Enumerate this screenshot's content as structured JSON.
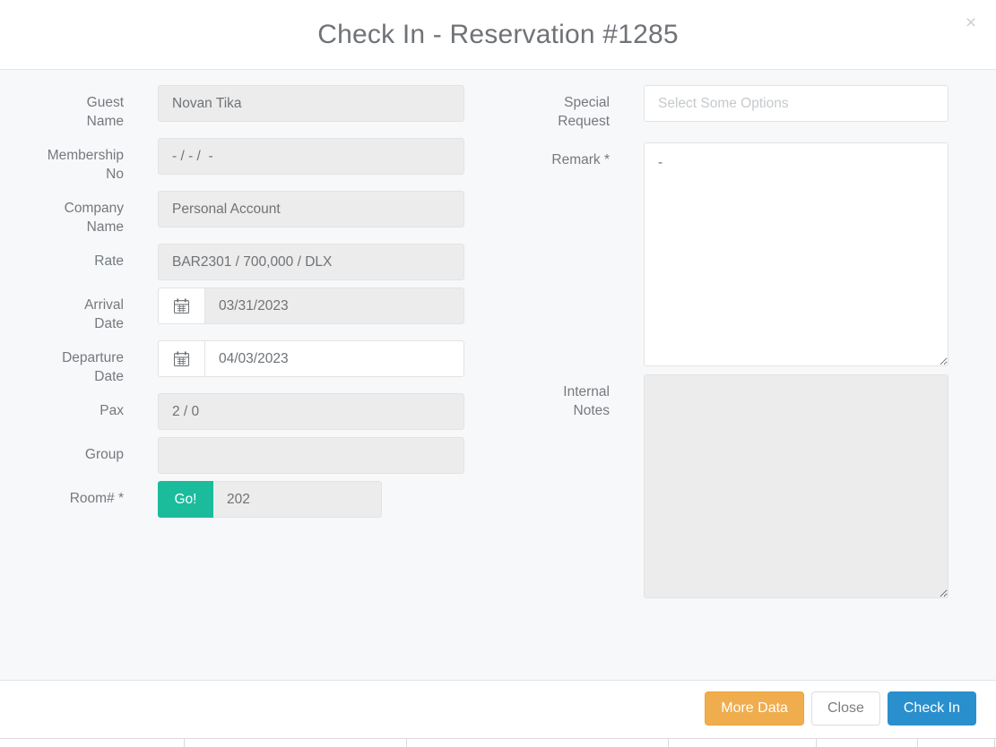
{
  "modal": {
    "title": "Check In - Reservation #1285",
    "close_icon": "close-icon",
    "close_glyph": "×"
  },
  "left_column": {
    "fields": [
      {
        "label": "Guest Name",
        "value": "Novan Tika",
        "type": "text",
        "disabled": true
      },
      {
        "label": "Membership No",
        "value": "- / - /  -",
        "type": "text",
        "disabled": true
      },
      {
        "label": "Company Name",
        "value": "Personal Account",
        "type": "text",
        "disabled": true
      },
      {
        "label": "Rate",
        "value": "BAR2301 / 700,000 / DLX",
        "type": "text",
        "disabled": true
      },
      {
        "label": "Arrival Date",
        "value": "03/31/2023",
        "type": "date",
        "disabled": true
      },
      {
        "label": "Departure Date",
        "value": "04/03/2023",
        "type": "date",
        "disabled": false
      },
      {
        "label": "Pax",
        "value": "2 / 0",
        "type": "text",
        "disabled": true
      },
      {
        "label": "Group",
        "value": "",
        "type": "text",
        "disabled": true
      },
      {
        "label": "Room# *",
        "value": "202",
        "type": "room",
        "disabled": true
      }
    ],
    "calendar_icon": "calendar-icon",
    "go_button_label": "Go!"
  },
  "right_column": {
    "special_request": {
      "label": "Special Request",
      "value": "",
      "placeholder": "Select Some Options"
    },
    "remark": {
      "label": "Remark *",
      "value": "-"
    },
    "internal_notes": {
      "label": "Internal Notes",
      "value": ""
    }
  },
  "footer": {
    "more_data_label": "More Data",
    "close_label": "Close",
    "check_in_label": "Check In"
  },
  "colors": {
    "accent_go": "#1abc9c",
    "accent_primary": "#2a8fcd",
    "accent_warning": "#f0ad4e",
    "body_bg": "#f7f8fa",
    "label_text": "#75797d"
  }
}
